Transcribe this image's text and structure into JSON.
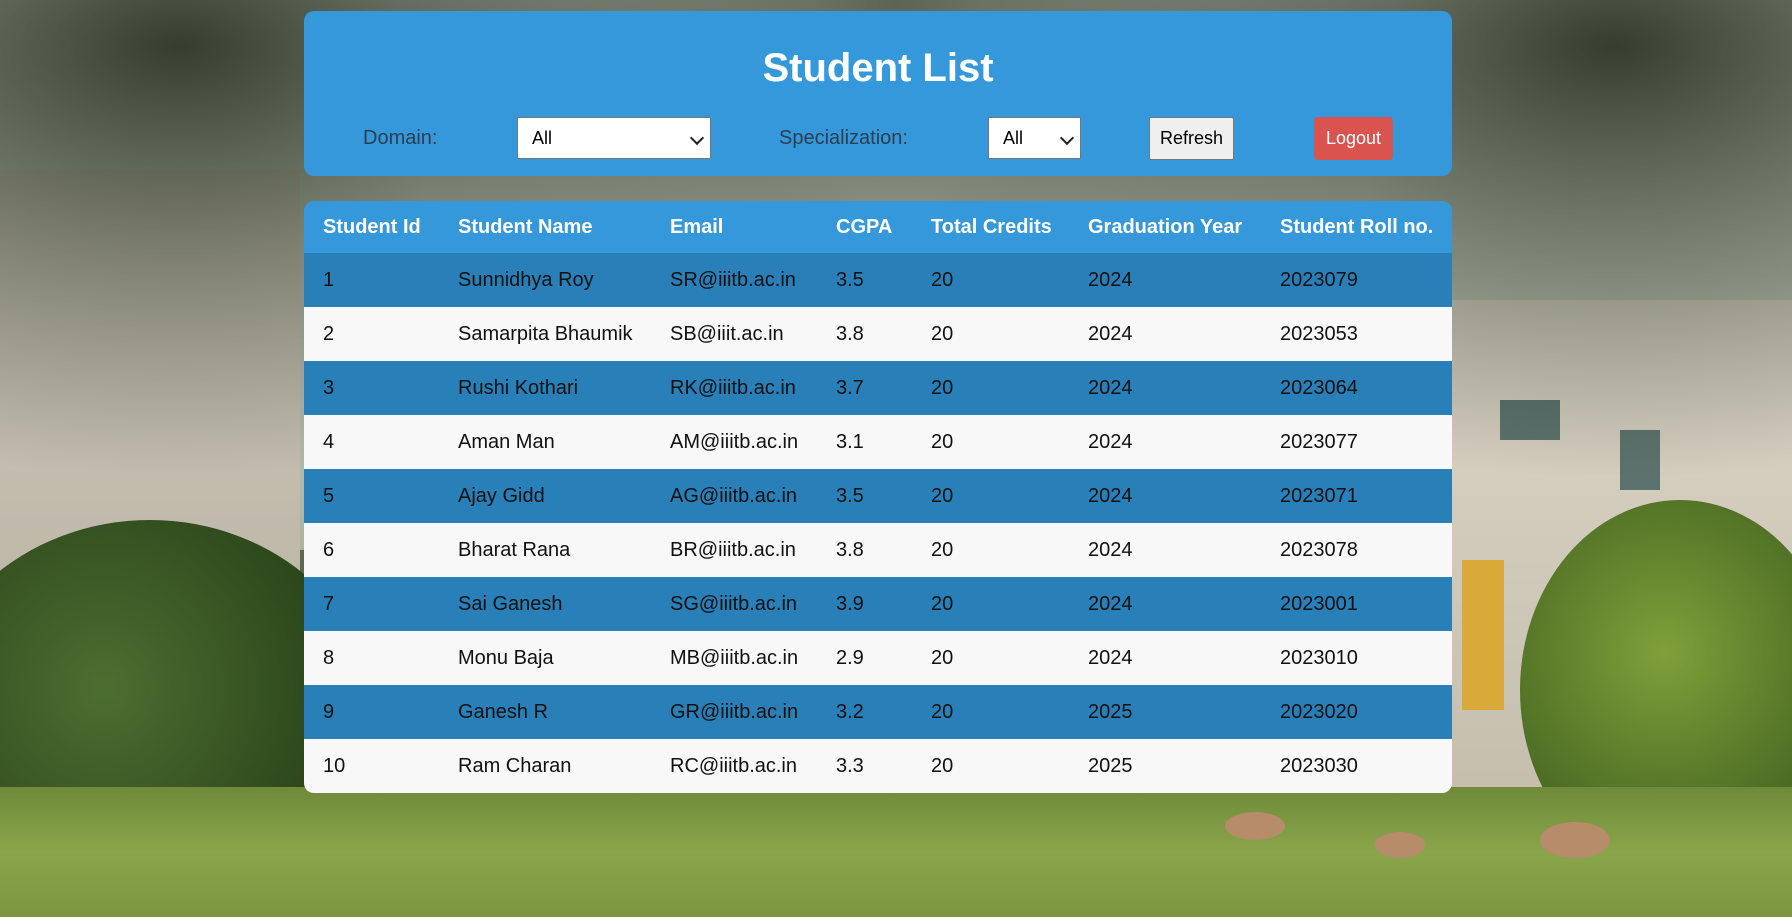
{
  "page": {
    "title": "Student List"
  },
  "filters": {
    "domain_label": "Domain:",
    "domain_value": "All",
    "specialization_label": "Specialization:",
    "specialization_value": "All"
  },
  "buttons": {
    "refresh": "Refresh",
    "logout": "Logout"
  },
  "colors": {
    "header_blue": "#3498db",
    "row_blue": "#2980b9",
    "row_light": "#f8f8f8",
    "logout_red": "#d9534f"
  },
  "table": {
    "columns": [
      "Student Id",
      "Student Name",
      "Email",
      "CGPA",
      "Total Credits",
      "Graduation Year",
      "Student Roll no."
    ],
    "rows": [
      [
        "1",
        "Sunnidhya Roy",
        "SR@iiitb.ac.in",
        "3.5",
        "20",
        "2024",
        "2023079"
      ],
      [
        "2",
        "Samarpita Bhaumik",
        "SB@iiit.ac.in",
        "3.8",
        "20",
        "2024",
        "2023053"
      ],
      [
        "3",
        "Rushi Kothari",
        "RK@iiitb.ac.in",
        "3.7",
        "20",
        "2024",
        "2023064"
      ],
      [
        "4",
        "Aman Man",
        "AM@iiitb.ac.in",
        "3.1",
        "20",
        "2024",
        "2023077"
      ],
      [
        "5",
        "Ajay Gidd",
        "AG@iiitb.ac.in",
        "3.5",
        "20",
        "2024",
        "2023071"
      ],
      [
        "6",
        "Bharat Rana",
        "BR@iiitb.ac.in",
        "3.8",
        "20",
        "2024",
        "2023078"
      ],
      [
        "7",
        "Sai Ganesh",
        "SG@iiitb.ac.in",
        "3.9",
        "20",
        "2024",
        "2023001"
      ],
      [
        "8",
        "Monu Baja",
        "MB@iiitb.ac.in",
        "2.9",
        "20",
        "2024",
        "2023010"
      ],
      [
        "9",
        "Ganesh R",
        "GR@iiitb.ac.in",
        "3.2",
        "20",
        "2025",
        "2023020"
      ],
      [
        "10",
        "Ram Charan",
        "RC@iiitb.ac.in",
        "3.3",
        "20",
        "2025",
        "2023030"
      ]
    ]
  }
}
